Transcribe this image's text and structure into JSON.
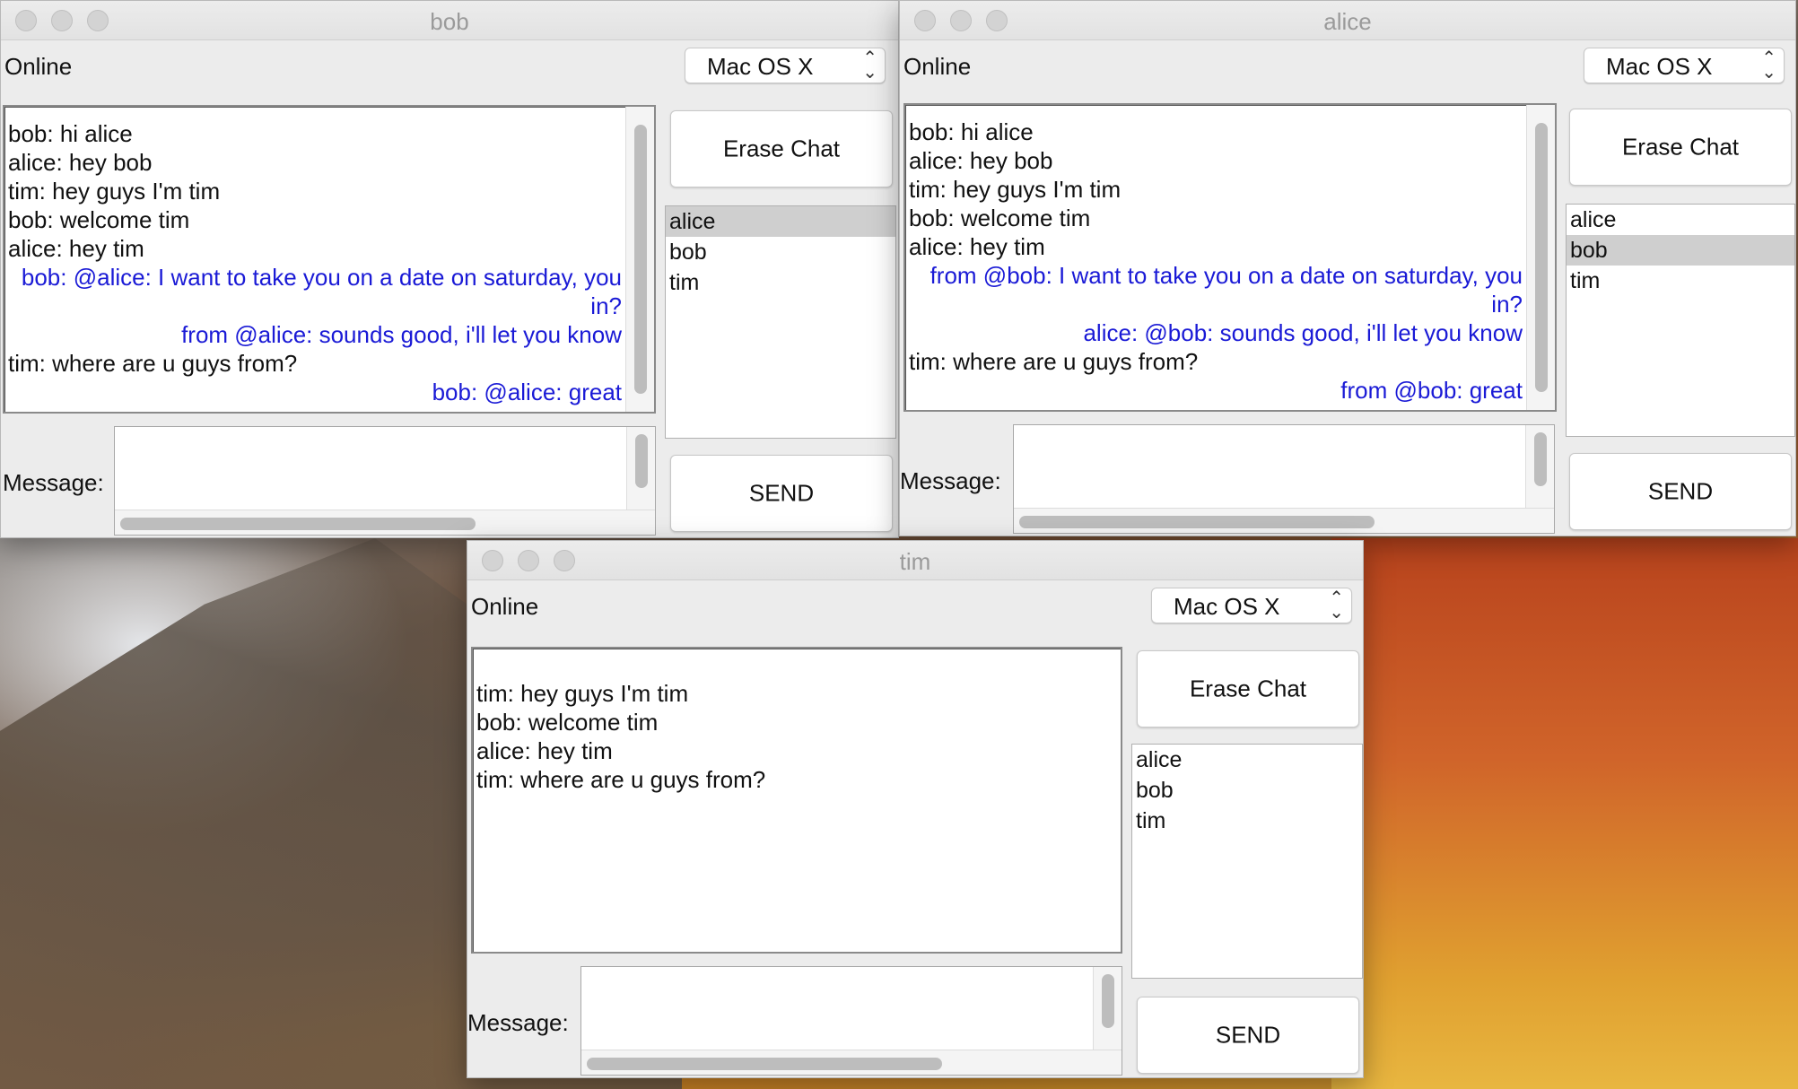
{
  "windows": [
    {
      "title": "bob",
      "status": "Online",
      "laf": "Mac OS X",
      "erase_label": "Erase Chat",
      "send_label": "SEND",
      "message_label": "Message:",
      "message_value": "",
      "users": [
        "alice",
        "bob",
        "tim"
      ],
      "selected_user": "alice",
      "chat": [
        {
          "text": "bob: hi alice",
          "private": false
        },
        {
          "text": "alice: hey bob",
          "private": false
        },
        {
          "text": "tim: hey guys I'm tim",
          "private": false
        },
        {
          "text": "bob: welcome tim",
          "private": false
        },
        {
          "text": "alice: hey tim",
          "private": false
        },
        {
          "text": "bob: @alice: I want to take you on a date on saturday, you in?",
          "private": true
        },
        {
          "text": "from @alice: sounds good, i'll let you know",
          "private": true
        },
        {
          "text": "tim: where are u guys from?",
          "private": false
        },
        {
          "text": "bob: @alice: great",
          "private": true
        }
      ]
    },
    {
      "title": "alice",
      "status": "Online",
      "laf": "Mac OS X",
      "erase_label": "Erase Chat",
      "send_label": "SEND",
      "message_label": "Message:",
      "message_value": "",
      "users": [
        "alice",
        "bob",
        "tim"
      ],
      "selected_user": "bob",
      "chat": [
        {
          "text": "bob: hi alice",
          "private": false
        },
        {
          "text": "alice: hey bob",
          "private": false
        },
        {
          "text": "tim: hey guys I'm tim",
          "private": false
        },
        {
          "text": "bob: welcome tim",
          "private": false
        },
        {
          "text": "alice: hey tim",
          "private": false
        },
        {
          "text": "from @bob: I want to take you on a date on saturday, you in?",
          "private": true
        },
        {
          "text": "alice: @bob: sounds good, i'll let you know",
          "private": true
        },
        {
          "text": "tim: where are u guys from?",
          "private": false
        },
        {
          "text": "from @bob: great",
          "private": true
        }
      ]
    },
    {
      "title": "tim",
      "status": "Online",
      "laf": "Mac OS X",
      "erase_label": "Erase Chat",
      "send_label": "SEND",
      "message_label": "Message:",
      "message_value": "",
      "users": [
        "alice",
        "bob",
        "tim"
      ],
      "selected_user": "",
      "chat": [
        {
          "text": "tim: hey guys I'm tim",
          "private": false
        },
        {
          "text": "bob: welcome tim",
          "private": false
        },
        {
          "text": "alice: hey tim",
          "private": false
        },
        {
          "text": "tim: where are u guys from?",
          "private": false
        }
      ]
    }
  ]
}
